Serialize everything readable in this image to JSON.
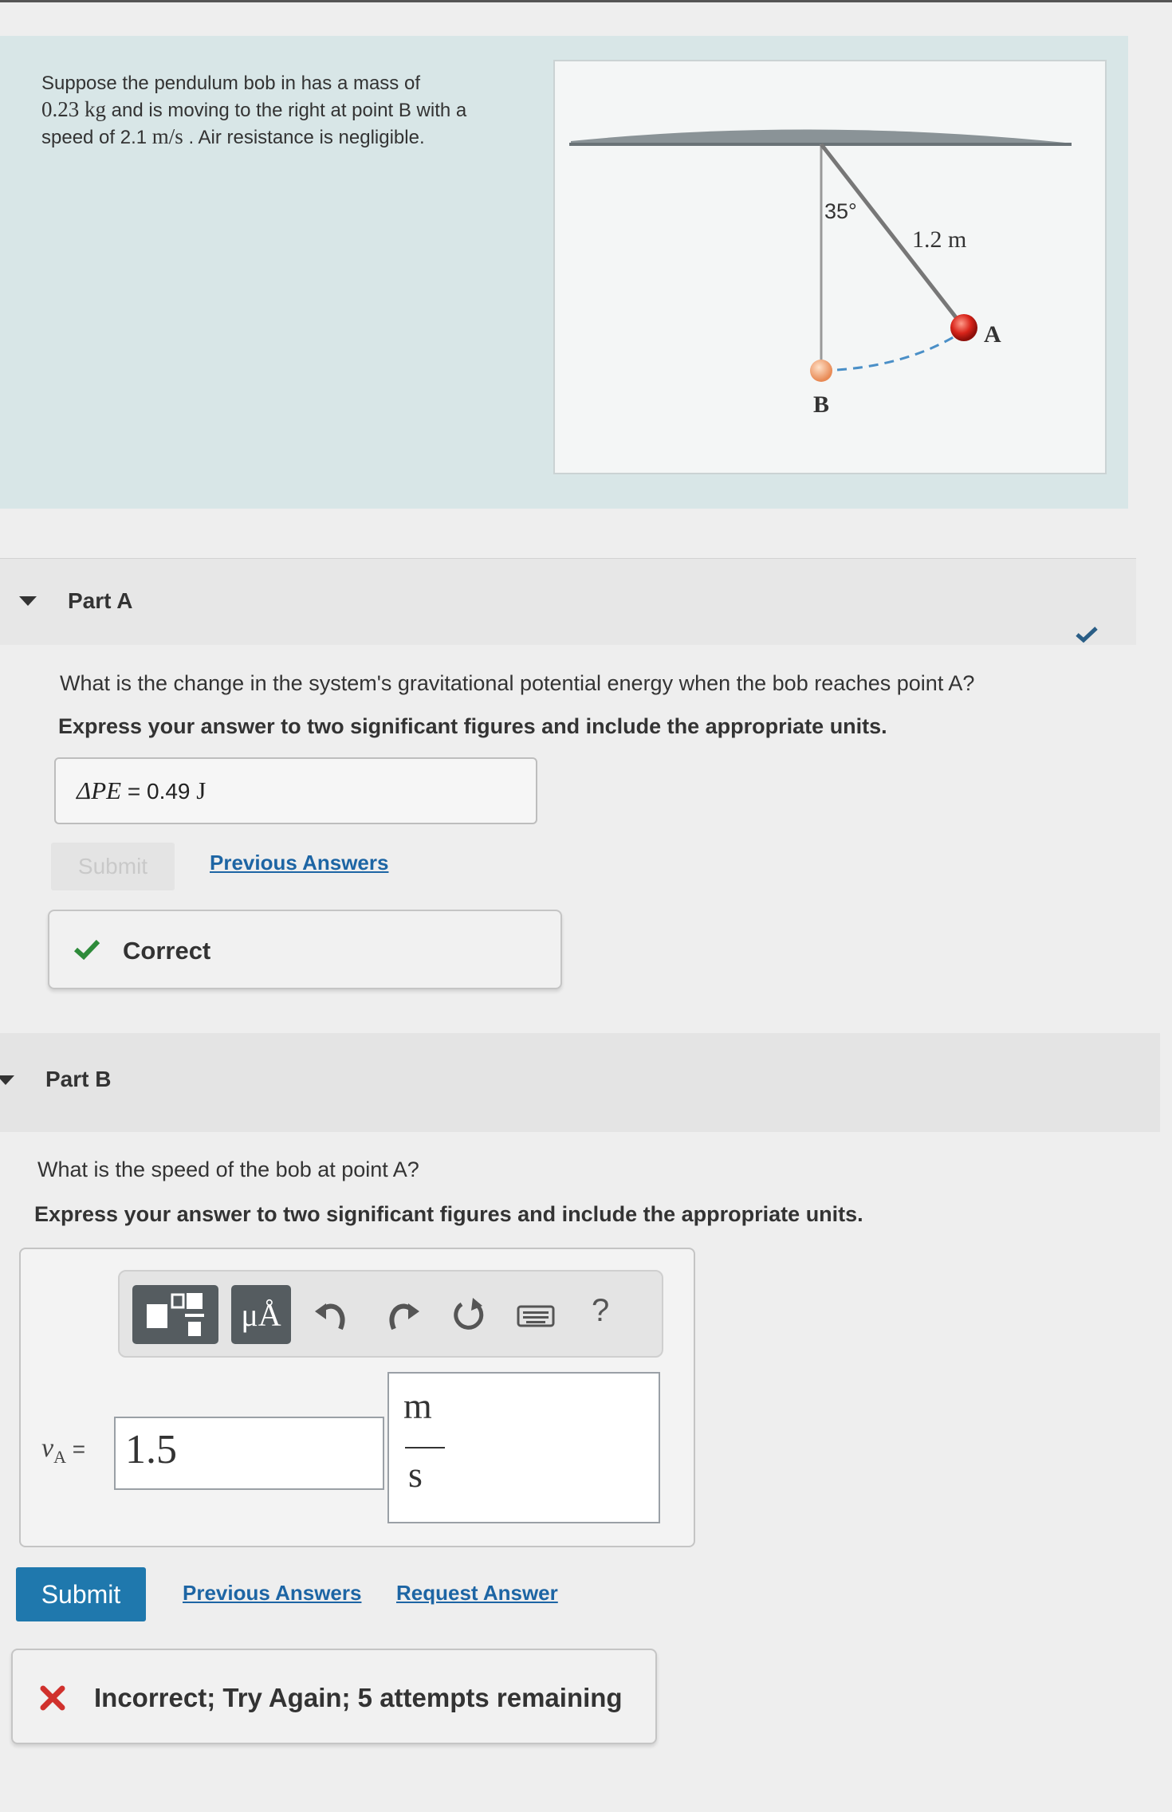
{
  "intro": {
    "line1": "Suppose the pendulum bob in has a mass of",
    "mass": "0.23 kg",
    "line2": " and is moving to the right at point B with a",
    "line3a": "speed of 2.1 ",
    "speed_unit": "m/s",
    "line3b": " . Air resistance is negligible."
  },
  "figure": {
    "angle": "35°",
    "length": "1.2 m",
    "point_a": "A",
    "point_b": "B"
  },
  "part_a": {
    "title": "Part A",
    "question": "What is the change in the system's gravitational potential energy when the bob reaches point A?",
    "instruction": "Express your answer to two significant figures and include the appropriate units.",
    "answer_label": "ΔPE",
    "answer_eq": " = ",
    "answer_value": "0.49",
    "answer_unit": " J",
    "submit_label": "Submit",
    "previous_answers": "Previous Answers",
    "feedback": "Correct"
  },
  "part_b": {
    "title": "Part B",
    "question": "What is the speed of the bob at point A?",
    "instruction": "Express your answer to two significant figures and include the appropriate units.",
    "toolbar": {
      "templates_icon": "fraction-template-icon",
      "units_label": "μÅ",
      "undo_icon": "undo-icon",
      "redo_icon": "redo-icon",
      "reset_icon": "reset-icon",
      "keyboard_icon": "keyboard-icon",
      "help_label": "?"
    },
    "var_label": "v",
    "var_sub": "A",
    "eq": " = ",
    "value": "1.5",
    "unit_num": "m",
    "unit_den": "s",
    "submit_label": "Submit",
    "previous_answers": "Previous Answers",
    "request_answer": "Request Answer",
    "feedback": "Incorrect; Try Again; 5 attempts remaining"
  },
  "colors": {
    "submit_blue": "#1f78ad",
    "link_blue": "#1d65a4",
    "correct_green": "#2e8b3a",
    "incorrect_red": "#d0312d",
    "intro_bg": "#d8e6e7"
  }
}
